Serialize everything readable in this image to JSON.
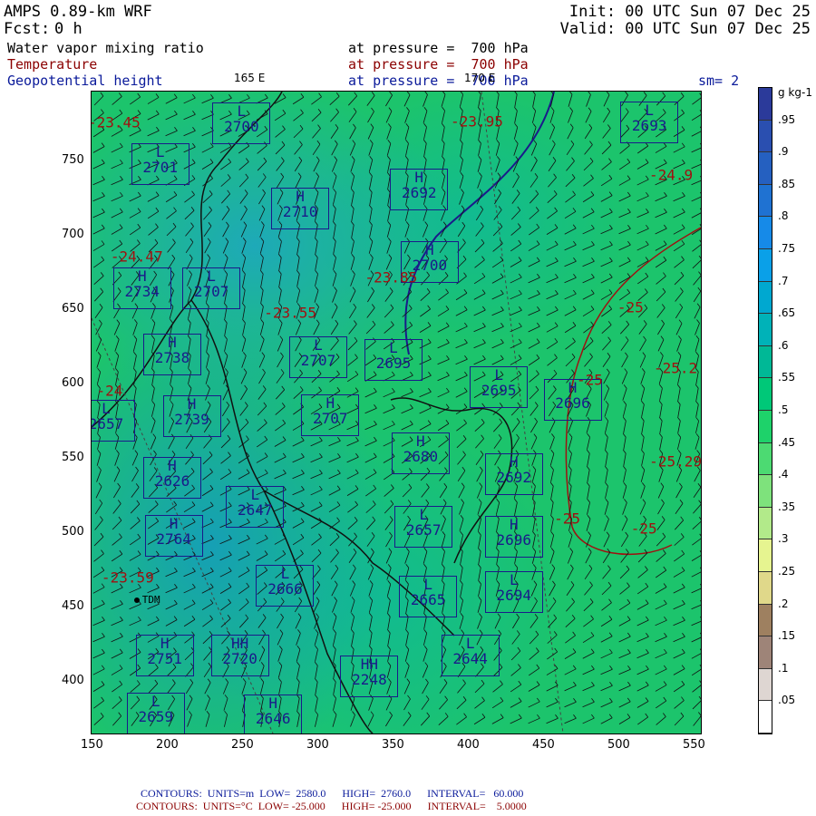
{
  "header": {
    "model": "AMPS 0.89-km WRF",
    "fcst_label": "Fcst:",
    "fcst_value": "0 h",
    "init": "Init: 00 UTC Sun 07 Dec 25",
    "valid": "Valid: 00 UTC Sun 07 Dec 25",
    "fields": [
      {
        "name": "Water vapor mixing ratio",
        "level": "at pressure =  700 hPa",
        "color": "#000000"
      },
      {
        "name": "Temperature",
        "level": "at pressure =  700 hPa",
        "color": "#8b0000"
      },
      {
        "name": "Geopotential height",
        "level": "at pressure =  700 hPa",
        "color": "#0a1a9a"
      }
    ],
    "smoothing": "sm= 2",
    "lon_labels": [
      "165 E",
      "170 E"
    ]
  },
  "axes": {
    "x_ticks": [
      150,
      200,
      250,
      300,
      350,
      400,
      450,
      500,
      550
    ],
    "y_ticks": [
      750,
      700,
      650,
      600,
      550,
      500,
      450,
      400
    ],
    "xlim": [
      120,
      560
    ],
    "ylim": [
      365,
      800
    ]
  },
  "height_centers": [
    {
      "t": "L",
      "v": "2700",
      "x": 249,
      "y": 776
    },
    {
      "t": "L",
      "v": "2701",
      "x": 195,
      "y": 749
    },
    {
      "t": "H",
      "v": "2710",
      "x": 288,
      "y": 719
    },
    {
      "t": "H",
      "v": "2692",
      "x": 367,
      "y": 732
    },
    {
      "t": "L",
      "v": "2693",
      "x": 520,
      "y": 777
    },
    {
      "t": "H",
      "v": "2700",
      "x": 374,
      "y": 683
    },
    {
      "t": "H",
      "v": "2734",
      "x": 183,
      "y": 665
    },
    {
      "t": "L",
      "v": "2707",
      "x": 229,
      "y": 665
    },
    {
      "t": "H",
      "v": "2738",
      "x": 203,
      "y": 621
    },
    {
      "t": "L",
      "v": "2707",
      "x": 300,
      "y": 619
    },
    {
      "t": "L",
      "v": "2695",
      "x": 350,
      "y": 617
    },
    {
      "t": "L",
      "v": "2695",
      "x": 420,
      "y": 599
    },
    {
      "t": "H",
      "v": "2696",
      "x": 469,
      "y": 590
    },
    {
      "t": "H",
      "v": "2739",
      "x": 216,
      "y": 579
    },
    {
      "t": "H",
      "v": "2707",
      "x": 308,
      "y": 580
    },
    {
      "t": "L",
      "v": "2657",
      "x": 159,
      "y": 576
    },
    {
      "t": "H",
      "v": "2680",
      "x": 368,
      "y": 554
    },
    {
      "t": "H",
      "v": "2626",
      "x": 203,
      "y": 538
    },
    {
      "t": "H",
      "v": "2692",
      "x": 430,
      "y": 540
    },
    {
      "t": "L",
      "v": "2647",
      "x": 258,
      "y": 518
    },
    {
      "t": "L",
      "v": "2657",
      "x": 370,
      "y": 505
    },
    {
      "t": "H",
      "v": "2764",
      "x": 204,
      "y": 499
    },
    {
      "t": "H",
      "v": "2696",
      "x": 430,
      "y": 498
    },
    {
      "t": "L",
      "v": "2694",
      "x": 430,
      "y": 461
    },
    {
      "t": "L",
      "v": "2666",
      "x": 278,
      "y": 465
    },
    {
      "t": "L",
      "v": "2665",
      "x": 373,
      "y": 458
    },
    {
      "t": "H",
      "v": "2751",
      "x": 198,
      "y": 418
    },
    {
      "t": "HH",
      "v": "2720",
      "x": 248,
      "y": 418
    },
    {
      "t": "L",
      "v": "2644",
      "x": 401,
      "y": 418
    },
    {
      "t": "HH",
      "v": "2248",
      "x": 334,
      "y": 404
    },
    {
      "t": "L",
      "v": "2659",
      "x": 192,
      "y": 379
    },
    {
      "t": "H",
      "v": "2646",
      "x": 270,
      "y": 378
    }
  ],
  "temperature_labels": [
    {
      "v": "-23.45",
      "x": 165,
      "y": 776
    },
    {
      "v": "-23.95",
      "x": 406,
      "y": 777
    },
    {
      "v": "-24.9",
      "x": 535,
      "y": 741
    },
    {
      "v": "-24.47",
      "x": 180,
      "y": 686
    },
    {
      "v": "-23.85",
      "x": 349,
      "y": 672
    },
    {
      "v": "-23.55",
      "x": 282,
      "y": 648
    },
    {
      "v": "-25",
      "x": 508,
      "y": 652
    },
    {
      "v": "-25.2",
      "x": 538,
      "y": 611
    },
    {
      "v": "-25",
      "x": 481,
      "y": 603
    },
    {
      "v": "-24",
      "x": 162,
      "y": 596
    },
    {
      "v": "-25.29",
      "x": 538,
      "y": 548
    },
    {
      "v": "-23.59",
      "x": 174,
      "y": 470
    },
    {
      "v": "-25",
      "x": 466,
      "y": 510
    },
    {
      "v": "-25",
      "x": 517,
      "y": 503
    }
  ],
  "station": {
    "name": "TDM",
    "x": 180,
    "y": 455
  },
  "colorbar": {
    "units": "g kg-1",
    "labels": [
      ".95",
      ".9",
      ".85",
      ".8",
      ".75",
      ".7",
      ".65",
      ".6",
      ".55",
      ".5",
      ".45",
      ".4",
      ".35",
      ".3",
      ".25",
      ".2",
      ".15",
      ".1",
      ".05"
    ],
    "colors": [
      "#2b3a9a",
      "#2a4fb0",
      "#2560c0",
      "#1f72d2",
      "#168ae8",
      "#0aa0e8",
      "#00a8d0",
      "#00b2b8",
      "#00b896",
      "#00c878",
      "#1ed26a",
      "#4cda72",
      "#7ee27c",
      "#b2ea8a",
      "#e6f490",
      "#e0d88a",
      "#9e8060",
      "#9e8478",
      "#ded6d2",
      "#ffffff"
    ]
  },
  "footer": {
    "height": {
      "contours": "CONTOURS:",
      "units": "UNITS=m",
      "low": "LOW=  2580.0",
      "high": "HIGH=  2760.0",
      "interval": "INTERVAL=   60.000"
    },
    "temp": {
      "contours": "CONTOURS:",
      "units": "UNITS=°C",
      "low": "LOW= -25.000",
      "high": "HIGH= -25.000",
      "interval": "INTERVAL=    5.0000"
    }
  }
}
